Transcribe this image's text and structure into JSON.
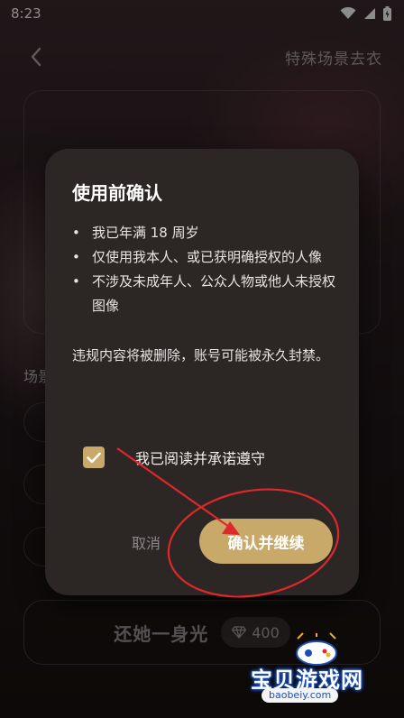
{
  "status_bar": {
    "time": "8:23"
  },
  "app_bar": {
    "title": "特殊场景去衣"
  },
  "background": {
    "scene_label": "场景",
    "bottom_button_label": "还她一身光",
    "cost": "400"
  },
  "dialog": {
    "title": "使用前确认",
    "rules": [
      {
        "bullet": "•",
        "text": "我已年满 18 周岁"
      },
      {
        "bullet": "•",
        "text": "仅使用我本人、或已获明确授权的人像"
      },
      {
        "bullet": "•",
        "text": "不涉及未成年人、公众人物或他人未授权图像"
      }
    ],
    "warning": "违规内容将被删除，账号可能被永久封禁。",
    "agree_label": "我已阅读并承诺遵守",
    "agree_checked": true,
    "cancel_label": "取消",
    "confirm_label": "确认并继续"
  },
  "colors": {
    "accent": "#c8a96a",
    "dialog_bg": "#2c2624",
    "annotation_red": "#e0272b"
  },
  "watermark": {
    "name": "宝贝游戏网",
    "url": "baobeiy.com"
  }
}
